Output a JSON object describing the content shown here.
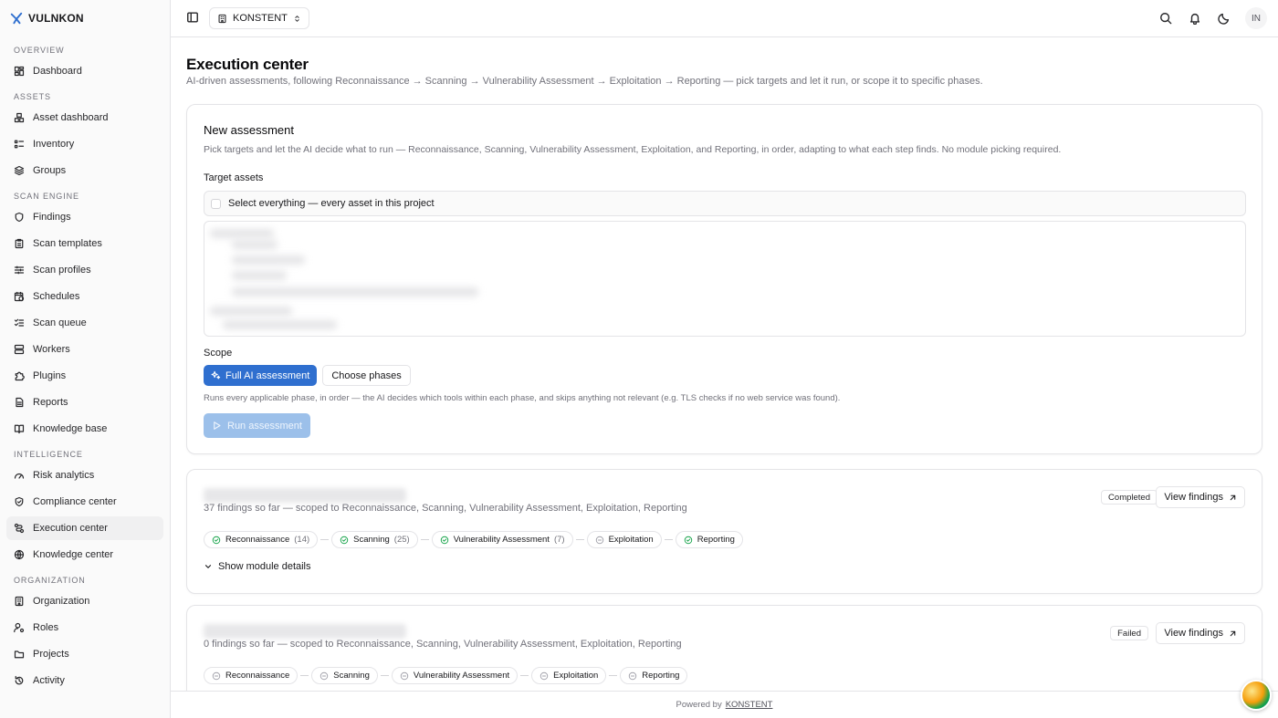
{
  "brand": {
    "name": "VULNKON"
  },
  "sidebar": {
    "sections": [
      {
        "label": "OVERVIEW",
        "items": [
          {
            "label": "Dashboard",
            "icon": "dashboard-icon"
          }
        ]
      },
      {
        "label": "ASSETS",
        "items": [
          {
            "label": "Asset dashboard",
            "icon": "boxes-icon"
          },
          {
            "label": "Inventory",
            "icon": "list-icon"
          },
          {
            "label": "Groups",
            "icon": "layers-icon"
          }
        ]
      },
      {
        "label": "SCAN ENGINE",
        "items": [
          {
            "label": "Findings",
            "icon": "shield-icon"
          },
          {
            "label": "Scan templates",
            "icon": "clipboard-icon"
          },
          {
            "label": "Scan profiles",
            "icon": "sliders-icon"
          },
          {
            "label": "Schedules",
            "icon": "calendar-clock-icon"
          },
          {
            "label": "Scan queue",
            "icon": "list-checks-icon"
          },
          {
            "label": "Workers",
            "icon": "server-icon"
          },
          {
            "label": "Plugins",
            "icon": "puzzle-icon"
          },
          {
            "label": "Reports",
            "icon": "file-text-icon"
          },
          {
            "label": "Knowledge base",
            "icon": "book-icon"
          }
        ]
      },
      {
        "label": "INTELLIGENCE",
        "items": [
          {
            "label": "Risk analytics",
            "icon": "gauge-icon"
          },
          {
            "label": "Compliance center",
            "icon": "shield-check-icon"
          },
          {
            "label": "Execution center",
            "icon": "route-icon",
            "active": true
          },
          {
            "label": "Knowledge center",
            "icon": "globe-icon"
          }
        ]
      },
      {
        "label": "ORGANIZATION",
        "items": [
          {
            "label": "Organization",
            "icon": "building-icon"
          },
          {
            "label": "Roles",
            "icon": "user-cog-icon"
          },
          {
            "label": "Projects",
            "icon": "folder-icon"
          },
          {
            "label": "Activity",
            "icon": "history-icon"
          }
        ]
      }
    ]
  },
  "header": {
    "project": "KONSTENT",
    "avatar": "IN"
  },
  "page": {
    "title": "Execution center",
    "subtitle": "AI-driven assessments, following Reconnaissance → Scanning → Vulnerability Assessment → Exploitation → Reporting — pick targets and let it run, or scope it to specific phases."
  },
  "new_assessment": {
    "title": "New assessment",
    "description": "Pick targets and let the AI decide what to run — Reconnaissance, Scanning, Vulnerability Assessment, Exploitation, and Reporting, in order, adapting to what each step finds. No module picking required.",
    "target_label": "Target assets",
    "select_all": "Select everything — every asset in this project",
    "scope_label": "Scope",
    "scope_full": "Full AI assessment",
    "scope_choose": "Choose phases",
    "scope_note": "Runs every applicable phase, in order — the AI decides which tools within each phase, and skips anything not relevant (e.g. TLS checks if no web service was found).",
    "run_button": "Run assessment"
  },
  "runs": [
    {
      "summary": "37 findings so far — scoped to Reconnaissance, Scanning, Vulnerability Assessment, Exploitation, Reporting",
      "status": "Completed",
      "view_findings": "View findings",
      "module_toggle": "Show module details",
      "phases": [
        {
          "label": "Reconnaissance",
          "count": "(14)",
          "state": "done"
        },
        {
          "label": "Scanning",
          "count": "(25)",
          "state": "done"
        },
        {
          "label": "Vulnerability Assessment",
          "count": "(7)",
          "state": "done"
        },
        {
          "label": "Exploitation",
          "count": "",
          "state": "idle"
        },
        {
          "label": "Reporting",
          "count": "",
          "state": "done"
        }
      ]
    },
    {
      "summary": "0 findings so far — scoped to Reconnaissance, Scanning, Vulnerability Assessment, Exploitation, Reporting",
      "status": "Failed",
      "view_findings": "View findings",
      "phases": [
        {
          "label": "Reconnaissance",
          "count": "",
          "state": "idle"
        },
        {
          "label": "Scanning",
          "count": "",
          "state": "idle"
        },
        {
          "label": "Vulnerability Assessment",
          "count": "",
          "state": "idle"
        },
        {
          "label": "Exploitation",
          "count": "",
          "state": "idle"
        },
        {
          "label": "Reporting",
          "count": "",
          "state": "idle"
        }
      ]
    }
  ],
  "footer": {
    "prefix": "Powered by",
    "link": "KONSTENT"
  },
  "colors": {
    "primary": "#2f6fcf",
    "success": "#16a34a",
    "border": "#e4e4e7",
    "muted_text": "#71717a"
  }
}
